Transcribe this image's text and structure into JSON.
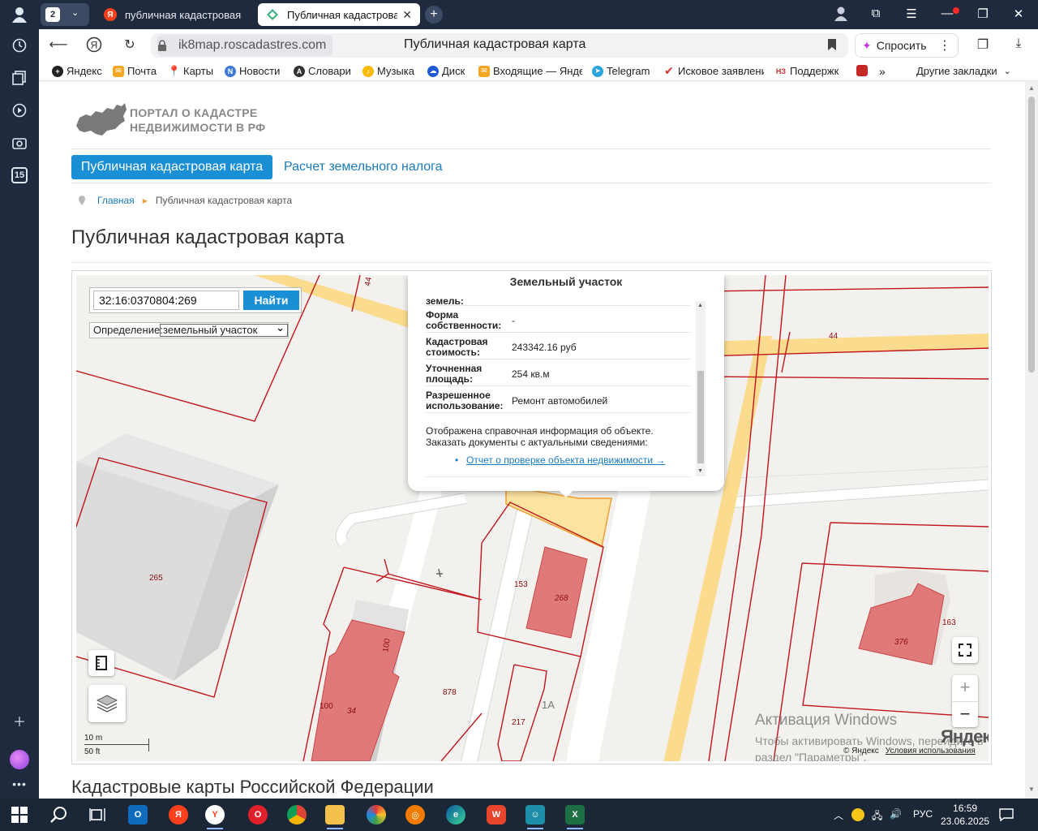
{
  "browser": {
    "tab_group_count": "2",
    "tabs": [
      {
        "title": "публичная кадастровая к",
        "active": false
      },
      {
        "title": "Публичная кадастровая",
        "active": true
      }
    ],
    "address_host": "ik8map.roscadastres.com",
    "page_title": "Публичная кадастровая карта",
    "ask_label": "Спросить",
    "bookmarks": [
      "Яндекс",
      "Почта",
      "Карты",
      "Новости",
      "Словари",
      "Музыка",
      "Диск",
      "Входящие — Янде",
      "Telegram",
      "Исковое заявлени",
      "Поддержк"
    ],
    "other_bookmarks": "Другие закладки",
    "sidebar_badge": "15"
  },
  "site": {
    "logo_line1": "ПОРТАЛ О КАДАСТРЕ",
    "logo_line2": "НЕДВИЖИМОСТИ В РФ",
    "nav_active": "Публичная кадастровая карта",
    "nav_link": "Расчет земельного налога",
    "breadcrumb_home": "Главная",
    "breadcrumb_current": "Публичная кадастровая карта",
    "heading": "Публичная кадастровая карта",
    "section_heading": "Кадастровые карты Российской Федерации"
  },
  "map": {
    "search_value": "32:16:0370804:269",
    "search_button": "Найти",
    "definition_label": "Определение:",
    "definition_value": "земельный участок",
    "scale_m": "10 m",
    "scale_ft": "50 ft",
    "brand": "Яндекс",
    "copyright": "© Яндекс",
    "terms": "Условия использования",
    "labels": {
      "road_44_a": "44",
      "road_44_b": "44",
      "p265": "265",
      "p153": "153",
      "p268": "268",
      "p376": "376",
      "p163": "163",
      "p100a": "100",
      "p100b": "100",
      "p34": "34",
      "p878": "878",
      "p217": "217",
      "p1a": "1А"
    }
  },
  "popup": {
    "title": "Земельный участок",
    "cut_label": "земель:",
    "rows": [
      {
        "key": "Форма собственности:",
        "value": "-"
      },
      {
        "key": "Кадастровая стоимость:",
        "value": "243342.16 руб"
      },
      {
        "key": "Уточненная площадь:",
        "value": "254 кв.м"
      },
      {
        "key": "Разрешенное использование:",
        "value": "Ремонт автомобилей"
      }
    ],
    "note_line1": "Отображена справочная информация об объекте.",
    "note_line2": "Заказать документы с актуальными сведениями:",
    "link": "Отчет о проверке объекта недвижимости →"
  },
  "watermark": {
    "line1": "Активация Windows",
    "line2": "Чтобы активировать Windows, перейдите в",
    "line3": "раздел \"Параметры\"."
  },
  "taskbar": {
    "lang": "РУС",
    "time": "16:59",
    "date": "23.06.2025"
  }
}
